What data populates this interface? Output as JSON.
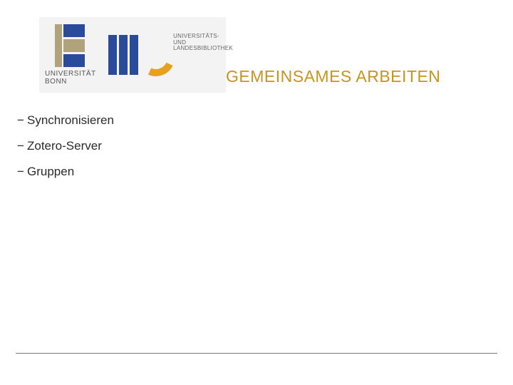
{
  "logos": {
    "uni_bonn_label": "UNIVERSITÄT BONN",
    "ulb_line1": "UNIVERSITÄTS-",
    "ulb_line2": "UND LANDESBIBLIOTHEK"
  },
  "title": "GEMEINSAMES ARBEITEN",
  "bullets": [
    "Synchronisieren",
    "Zotero-Server",
    "Gruppen"
  ],
  "colors": {
    "accent": "#c7941e",
    "brand_blue": "#2a4a9a",
    "brand_gold": "#e4a21f"
  }
}
